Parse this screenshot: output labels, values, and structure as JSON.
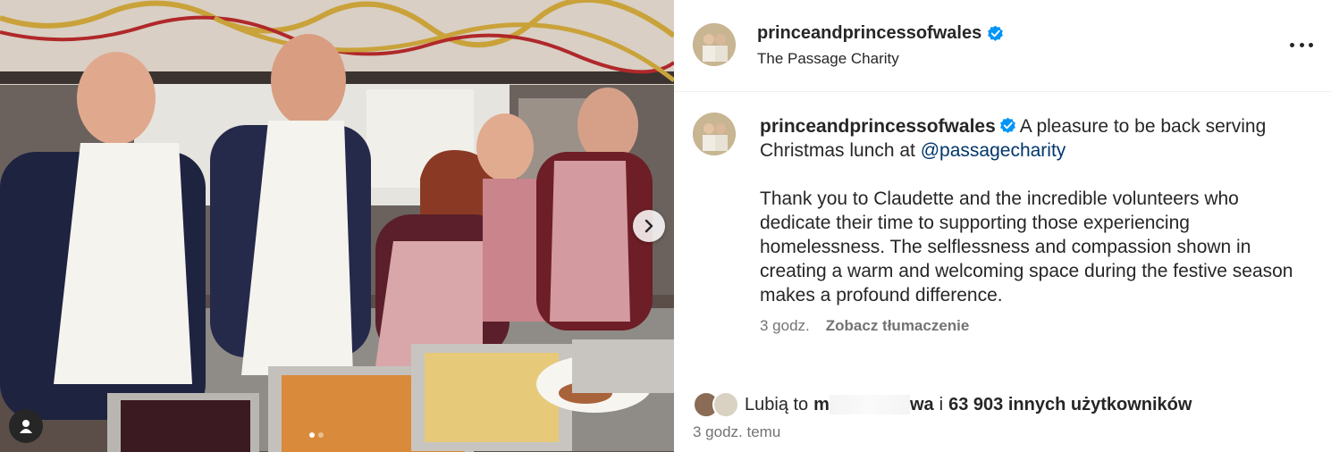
{
  "post": {
    "carousel": {
      "slide_count": 2,
      "active_index": 0
    },
    "header": {
      "username": "princeandprincessofwales",
      "verified": true,
      "location": "The Passage Charity"
    },
    "caption": {
      "username": "princeandprincessofwales",
      "text_start": "A pleasure to be back serving Christmas lunch at ",
      "mention": "@passagecharity",
      "paragraph2": "Thank you to Claudette and the incredible volunteers who dedicate their time to supporting those experiencing homelessness. The selflessness and compassion shown in creating a warm and welcoming space during the festive season makes a profound difference."
    },
    "meta": {
      "time": "3 godz.",
      "translate_label": "Zobacz tłumaczenie"
    },
    "likes": {
      "prefix": "Lubią to",
      "name_start": "m",
      "name_end": "wa",
      "connector": "i",
      "count_text": "63 903 innych użytkowników"
    },
    "time_ago": "3 godz. temu"
  },
  "icons": {
    "verified": "verified-badge-icon",
    "more": "more-options-icon",
    "next": "chevron-right-icon",
    "user_tag": "user-tag-icon"
  },
  "colors": {
    "verified_blue": "#0095f6",
    "mention_blue": "#00376b",
    "secondary_text": "#737373"
  }
}
